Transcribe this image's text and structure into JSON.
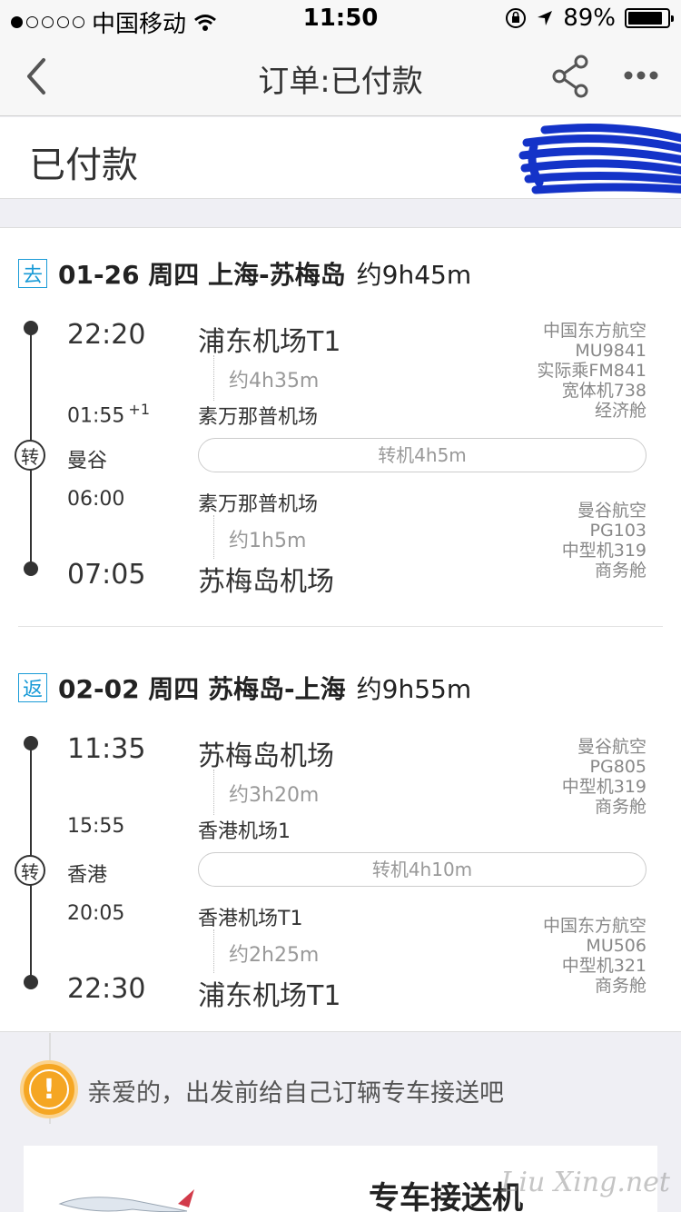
{
  "status_bar": {
    "carrier": "中国移动",
    "time": "11:50",
    "battery": "89%",
    "battery_level": 0.89,
    "signal_bars_filled": 1,
    "signal_bars_total": 5
  },
  "nav": {
    "title": "订单:已付款"
  },
  "order_status": {
    "label": "已付款"
  },
  "outbound": {
    "tag": "去",
    "title": "01-26 周四 上海-苏梅岛",
    "duration": "约9h45m",
    "seg1": {
      "dep_time": "22:20",
      "dep_airport": "浦东机场T1",
      "duration": "约4h35m",
      "arr_time": "01:55",
      "arr_day": "+1",
      "arr_airport": "素万那普机场",
      "info": [
        "中国东方航空",
        "MU9841",
        "实际乘FM841",
        "宽体机738",
        "经济舱"
      ]
    },
    "transfer": {
      "icon": "转",
      "city": "曼谷",
      "label": "转机4h5m"
    },
    "seg2": {
      "dep_time": "06:00",
      "dep_airport": "素万那普机场",
      "duration": "约1h5m",
      "arr_time": "07:05",
      "arr_airport": "苏梅岛机场",
      "info": [
        "曼谷航空",
        "PG103",
        "中型机319",
        "商务舱"
      ]
    }
  },
  "return": {
    "tag": "返",
    "title": "02-02 周四 苏梅岛-上海",
    "duration": "约9h55m",
    "seg1": {
      "dep_time": "11:35",
      "dep_airport": "苏梅岛机场",
      "duration": "约3h20m",
      "arr_time": "15:55",
      "arr_airport": "香港机场1",
      "info": [
        "曼谷航空",
        "PG805",
        "中型机319",
        "商务舱"
      ]
    },
    "transfer": {
      "icon": "转",
      "city": "香港",
      "label": "转机4h10m"
    },
    "seg2": {
      "dep_time": "20:05",
      "dep_airport": "香港机场T1",
      "duration": "约2h25m",
      "arr_time": "22:30",
      "arr_airport": "浦东机场T1",
      "info": [
        "中国东方航空",
        "MU506",
        "中型机321",
        "商务舱"
      ]
    }
  },
  "tip": {
    "icon": "!",
    "text": "亲爱的，出发前给自己订辆专车接送吧"
  },
  "car_service": {
    "title": "专车接送机"
  },
  "watermark": "Liu Xing.net",
  "colors": {
    "accent": "#1a9bd7",
    "warning": "#f5a623",
    "redaction": "#1433c8"
  }
}
